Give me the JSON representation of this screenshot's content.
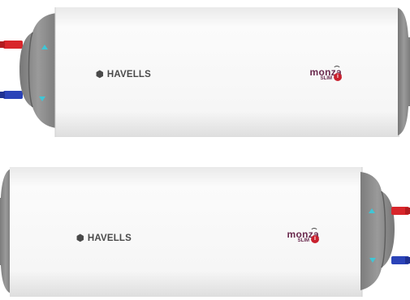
{
  "heaters": [
    {
      "brand": "HAVELLS",
      "model_name": "monza",
      "model_sub": "SLIM",
      "model_badge": "i",
      "orientation": "pipes-left"
    },
    {
      "brand": "HAVELLS",
      "model_name": "monza",
      "model_sub": "SLIM",
      "model_badge": "i",
      "orientation": "pipes-right"
    }
  ],
  "colors": {
    "body": "#f7f7f7",
    "cap": "#8d8d8d",
    "cap_dark": "#6e6e6e",
    "hot_pipe": "#d8262b",
    "cold_pipe": "#2b43b8",
    "indicator": "#3fc6d6",
    "brand_text": "#4a4a4a",
    "model_text": "#6a2a4e",
    "badge": "#c9202e"
  },
  "icons": [
    "havells-logo-icon",
    "wifi-icon",
    "up-arrow-indicator-icon",
    "down-arrow-indicator-icon"
  ]
}
